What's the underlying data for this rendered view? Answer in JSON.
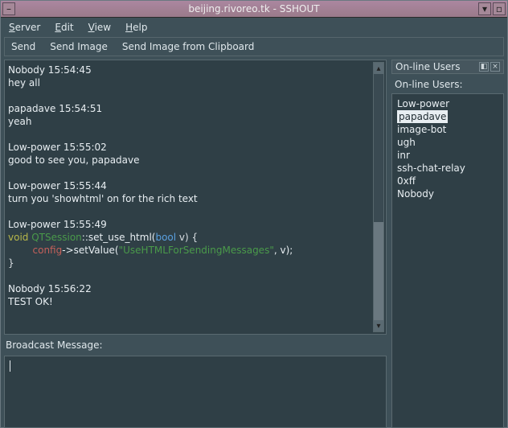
{
  "title": "beijing.rivoreo.tk - SSHOUT",
  "menubar": {
    "server": "Server",
    "edit": "Edit",
    "view": "View",
    "help": "Help"
  },
  "toolbar": {
    "send": "Send",
    "send_image": "Send Image",
    "send_clip": "Send Image from Clipboard"
  },
  "messages": [
    {
      "header": "Nobody 15:54:45",
      "body": "hey all"
    },
    {
      "header": "papadave 15:54:51",
      "body": "yeah"
    },
    {
      "header": "Low-power 15:55:02",
      "body": "good to see you, papadave"
    },
    {
      "header": "Low-power 15:55:44",
      "body": "turn you 'showhtml' on for the rich text"
    }
  ],
  "code_msg": {
    "header": "Low-power 15:55:49",
    "l1_kw": "void",
    "l1_cls": " QTSession",
    "l1_fn": "::set_use_html(",
    "l1_type": "bool",
    "l1_end": " v) {",
    "l2_pre": "        ",
    "l2_mem": "config",
    "l2_mid": "->setValue(",
    "l2_str": "\"UseHTMLForSendingMessages\"",
    "l2_end": ", v);",
    "l3": "}"
  },
  "last_msg": {
    "header": "Nobody 15:56:22",
    "body": "TEST OK!"
  },
  "broadcast_label": "Broadcast Message:",
  "users_panel": {
    "title": "On-line Users",
    "subtitle": "On-line Users:",
    "list": [
      "Low-power",
      "papadave",
      "image-bot",
      "ugh",
      "inr",
      "ssh-chat-relay",
      "0xff",
      "Nobody"
    ],
    "selected": "papadave"
  }
}
